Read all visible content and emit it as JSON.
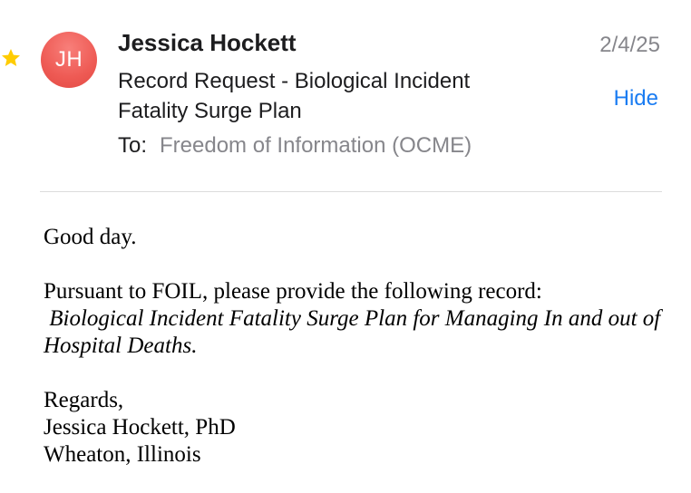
{
  "colors": {
    "star": "#ffcc00",
    "avatar": "#ee5a54",
    "link": "#1a7cf2",
    "secondary_text": "#86868b"
  },
  "message": {
    "starred": true,
    "star_icon": "star-icon",
    "avatar_initials": "JH",
    "sender": "Jessica Hockett",
    "date": "2/4/25",
    "subject": "Record Request - Biological Incident Fatality Surge Plan",
    "hide_label": "Hide",
    "to_label": "To:",
    "recipient": "Freedom of Information (OCME)"
  },
  "body": {
    "greeting": "Good day.",
    "request_line": "Pursuant to FOIL, please provide the following record:",
    "record_title": "Biological Incident Fatality Surge Plan for Managing In and out of Hospital Deaths.",
    "closing": "Regards,",
    "signature_name": "Jessica Hockett, PhD",
    "signature_location": "Wheaton, Illinois"
  }
}
